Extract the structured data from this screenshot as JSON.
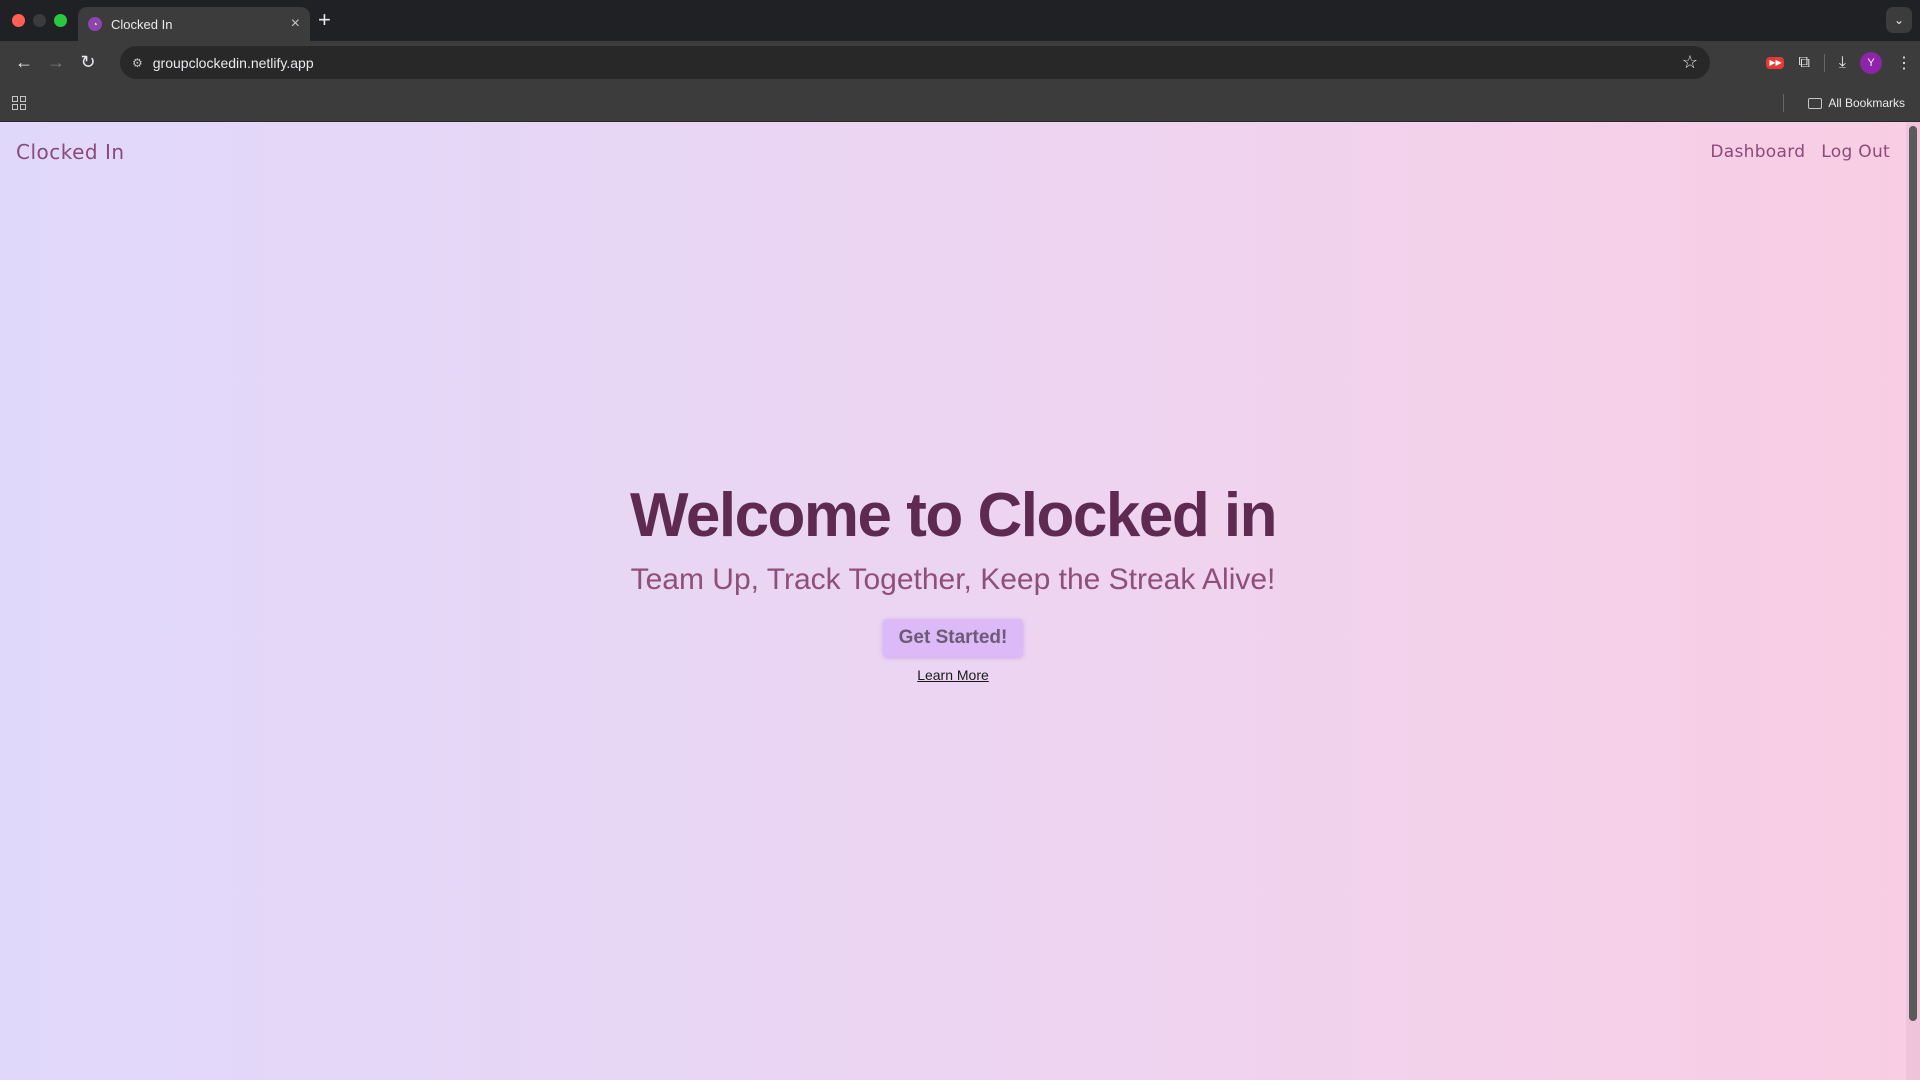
{
  "browser": {
    "tab": {
      "title": "Clocked In",
      "favicon_icon": "clock-favicon-icon"
    },
    "address_bar": {
      "url": "groupclockedin.netlify.app"
    },
    "avatar_initial": "Y",
    "bookmarks_bar": {
      "all_bookmarks_label": "All Bookmarks"
    }
  },
  "site": {
    "brand": "Clocked In",
    "nav": {
      "dashboard": "Dashboard",
      "logout": "Log Out"
    },
    "hero": {
      "title": "Welcome to Clocked in",
      "subtitle": "Team Up, Track Together, Keep the Streak Alive!",
      "cta_label": "Get Started!",
      "learn_more": "Learn More"
    }
  },
  "colors": {
    "gradient_start": "#e0d8fb",
    "gradient_end": "#f9cde4",
    "brand_text": "#8b4a78",
    "title_text": "#5e2a52",
    "button_bg": "#dcb9f7"
  }
}
